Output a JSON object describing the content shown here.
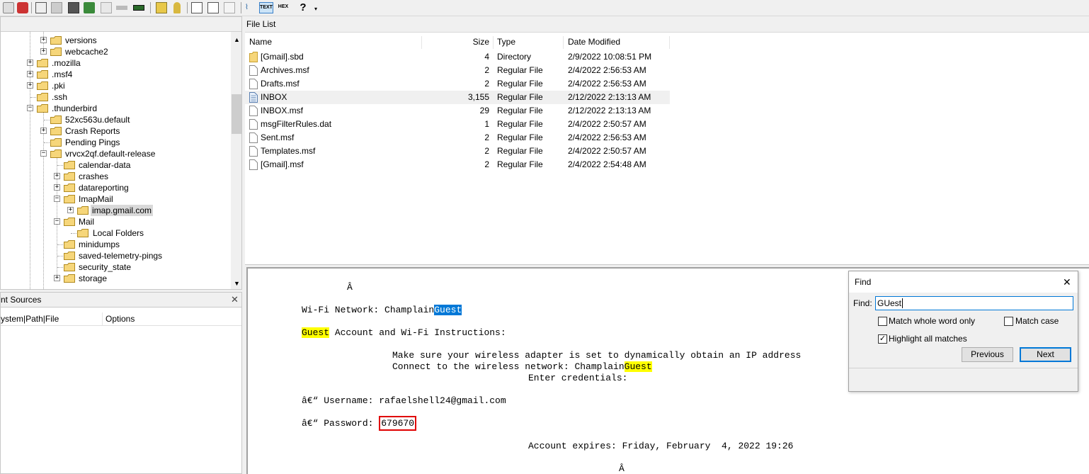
{
  "tree": {
    "items": [
      {
        "label": "versions"
      },
      {
        "label": "webcache2"
      },
      {
        "label": ".mozilla"
      },
      {
        "label": ".msf4"
      },
      {
        "label": ".pki"
      },
      {
        "label": ".ssh"
      },
      {
        "label": ".thunderbird"
      },
      {
        "label": "52xc563u.default"
      },
      {
        "label": "Crash Reports"
      },
      {
        "label": "Pending Pings"
      },
      {
        "label": "vrvcx2qf.default-release"
      },
      {
        "label": "calendar-data"
      },
      {
        "label": "crashes"
      },
      {
        "label": "datareporting"
      },
      {
        "label": "ImapMail"
      },
      {
        "label": "imap.gmail.com"
      },
      {
        "label": "Mail"
      },
      {
        "label": "Local Folders"
      },
      {
        "label": "minidumps"
      },
      {
        "label": "saved-telemetry-pings"
      },
      {
        "label": "security_state"
      },
      {
        "label": "storage"
      }
    ]
  },
  "sources": {
    "title": "nt Sources",
    "col_path": "ystem|Path|File",
    "col_options": "Options"
  },
  "filelist": {
    "title": "File List",
    "columns": {
      "name": "Name",
      "size": "Size",
      "type": "Type",
      "date": "Date Modified"
    },
    "rows": [
      {
        "name": "[Gmail].sbd",
        "size": "4",
        "type": "Directory",
        "date": "2/9/2022 10:08:51 PM"
      },
      {
        "name": "Archives.msf",
        "size": "2",
        "type": "Regular File",
        "date": "2/4/2022 2:56:53 AM"
      },
      {
        "name": "Drafts.msf",
        "size": "2",
        "type": "Regular File",
        "date": "2/4/2022 2:56:53 AM"
      },
      {
        "name": "INBOX",
        "size": "3,155",
        "type": "Regular File",
        "date": "2/12/2022 2:13:13 AM"
      },
      {
        "name": "INBOX.msf",
        "size": "29",
        "type": "Regular File",
        "date": "2/12/2022 2:13:13 AM"
      },
      {
        "name": "msgFilterRules.dat",
        "size": "1",
        "type": "Regular File",
        "date": "2/4/2022 2:50:57 AM"
      },
      {
        "name": "Sent.msf",
        "size": "2",
        "type": "Regular File",
        "date": "2/4/2022 2:56:53 AM"
      },
      {
        "name": "Templates.msf",
        "size": "2",
        "type": "Regular File",
        "date": "2/4/2022 2:50:57 AM"
      },
      {
        "name": "[Gmail].msf",
        "size": "2",
        "type": "Regular File",
        "date": "2/4/2022 2:54:48 AM"
      }
    ]
  },
  "textview": {
    "l1": "Â",
    "l2a": "Wi-Fi Network: Champlain",
    "l2b": "Guest",
    "l3a": "Guest",
    "l3b": " Account and Wi-Fi Instructions:",
    "l4": "Make sure your wireless adapter is set to dynamically obtain an IP address",
    "l5a": "Connect to the wireless network: Champlain",
    "l5b": "Guest",
    "l6": "Enter credentials:",
    "l7": "â€“ Username: rafaelshell24@gmail.com",
    "l8a": "â€“ Password: ",
    "l8b": "679670",
    "l9": "Account expires: Friday, February  4, 2022 19:26",
    "l10": "Â"
  },
  "find": {
    "title": "Find",
    "find_label": "Find:",
    "find_value": "GUest",
    "match_whole_word": "Match whole word only",
    "match_case": "Match case",
    "highlight_all": "Highlight all matches",
    "previous": "Previous",
    "next": "Next"
  },
  "toolbar": {
    "text_btn": "TEXT",
    "hex_btn": "HEX",
    "help_icon": "?"
  },
  "colors": {
    "highlight": "#ffff00",
    "selected_match": "#0078d7",
    "redbox": "#e00000"
  }
}
